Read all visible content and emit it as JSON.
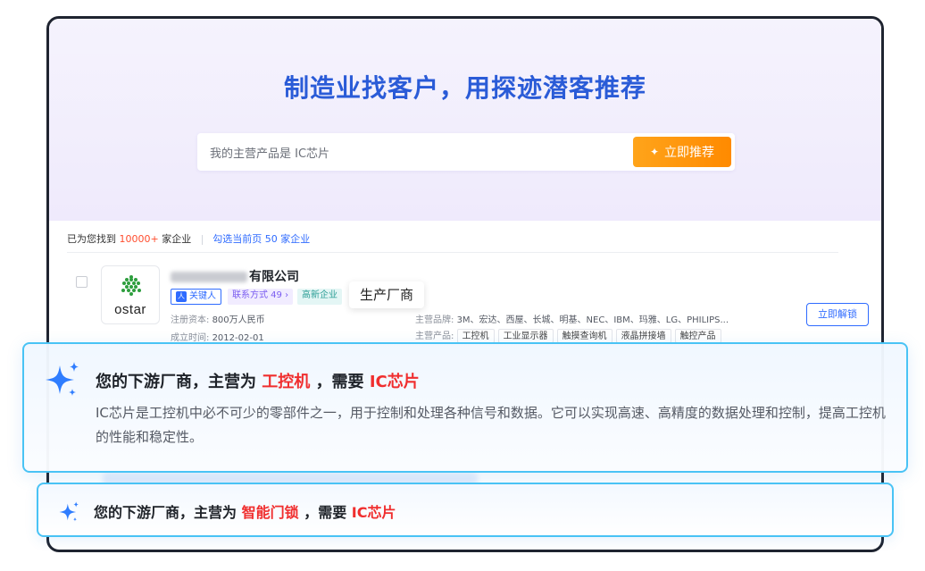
{
  "hero": {
    "title": "制造业找客户，用探迹潜客推荐",
    "search_text": "我的主营产品是 IC芯片",
    "search_button": "立即推荐"
  },
  "results": {
    "prefix": "已为您找到",
    "count": "10000+",
    "suffix": "家企业",
    "select_link": "勾选当前页 50 家企业"
  },
  "company": {
    "logo_text": "ostar",
    "name_visible": "有限公司",
    "tags": {
      "key_person": "关键人",
      "contact": "联系方式 49 ›",
      "tech": "高新企业"
    },
    "tooltip": "生产厂商",
    "capital_label": "注册资本:",
    "capital_value": "800万人民币",
    "founded_label": "成立时间:",
    "founded_value": "2012-02-01",
    "brands_label": "主营品牌:",
    "brands_value": "3M、宏达、西屋、长城、明基、NEC、IBM、玛雅、LG、PHILIPS...",
    "products_label": "主营产品:",
    "products": [
      "工控机",
      "工业显示器",
      "触摸查询机",
      "液晶拼接墙",
      "触控产品"
    ],
    "unlock_button": "立即解锁"
  },
  "card_big": {
    "title_prefix": "您的下游厂商，主营为",
    "highlight_product": "工控机",
    "title_mid": "，需要",
    "highlight_need": "IC芯片",
    "description": "IC芯片是工控机中必不可少的零部件之一，用于控制和处理各种信号和数据。它可以实现高速、高精度的数据处理和控制，提高工控机的性能和稳定性。"
  },
  "card_small": {
    "title_prefix": "您的下游厂商，主营为",
    "highlight_product": "智能门锁",
    "title_mid": "，需要",
    "highlight_need": "IC芯片"
  },
  "colors": {
    "title_blue": "#2a5bd7",
    "accent_orange": "#ff8a00",
    "highlight_red": "#f02e2e",
    "card_border": "#49c3f5",
    "link_blue": "#2f6bff"
  }
}
